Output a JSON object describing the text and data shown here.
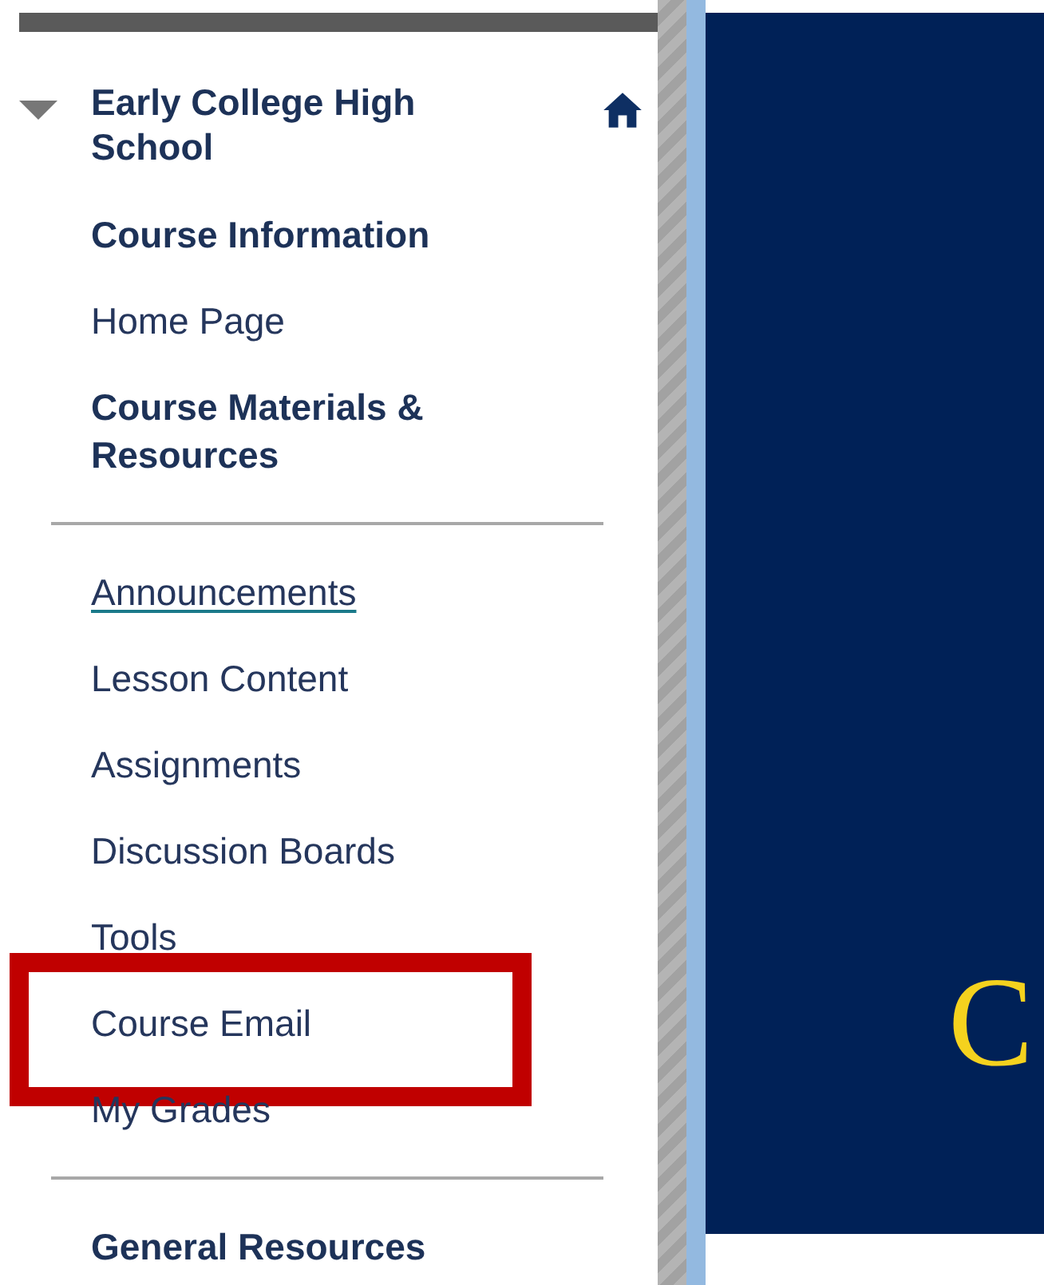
{
  "course_menu": {
    "title": "Early College High School",
    "expanded": true
  },
  "groups": [
    {
      "items": [
        {
          "label": "Course Information",
          "kind": "header"
        },
        {
          "label": "Home Page",
          "kind": "link"
        },
        {
          "label": "Course Materials & Resources",
          "kind": "header"
        }
      ]
    },
    {
      "items": [
        {
          "label": "Announcements",
          "kind": "link",
          "underlined": true
        },
        {
          "label": "Lesson Content",
          "kind": "link"
        },
        {
          "label": "Assignments",
          "kind": "link"
        },
        {
          "label": "Discussion Boards",
          "kind": "link"
        },
        {
          "label": "Tools",
          "kind": "link"
        },
        {
          "label": "Course Email",
          "kind": "link",
          "highlighted": true
        },
        {
          "label": "My Grades",
          "kind": "link"
        }
      ]
    },
    {
      "items": [
        {
          "label": "General Resources",
          "kind": "header"
        }
      ]
    }
  ],
  "banner": {
    "text": "C"
  }
}
